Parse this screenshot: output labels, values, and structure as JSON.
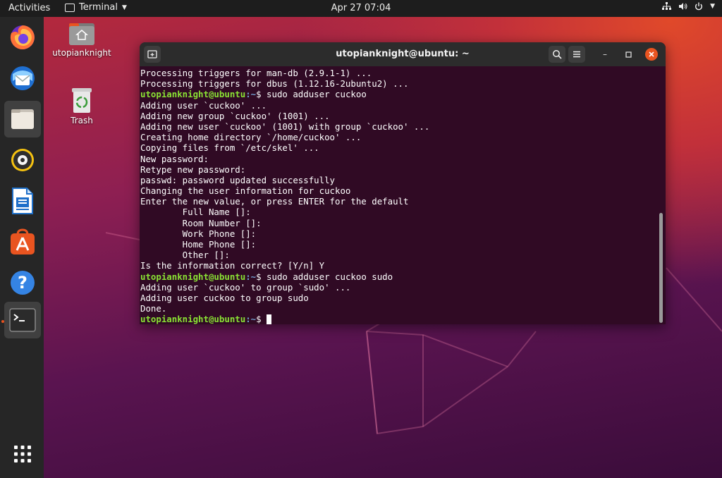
{
  "topbar": {
    "activities": "Activities",
    "app_name": "Terminal",
    "clock": "Apr 27  07:04",
    "status_icons": [
      "network-icon",
      "volume-icon",
      "power-icon",
      "menu-caret-icon"
    ]
  },
  "dock": {
    "items": [
      {
        "name": "firefox",
        "icon": "firefox-icon"
      },
      {
        "name": "thunderbird",
        "icon": "thunderbird-icon"
      },
      {
        "name": "files",
        "icon": "files-icon"
      },
      {
        "name": "rhythmbox",
        "icon": "rhythmbox-icon"
      },
      {
        "name": "libreoffice-writer",
        "icon": "writer-icon"
      },
      {
        "name": "software",
        "icon": "software-center-icon"
      },
      {
        "name": "help",
        "icon": "help-icon"
      },
      {
        "name": "terminal",
        "icon": "terminal-icon"
      }
    ],
    "show_apps_icon": "grid-icon"
  },
  "desktop": {
    "home_label": "utopianknight",
    "trash_label": "Trash"
  },
  "terminal": {
    "title": "utopianknight@ubuntu: ~",
    "prompt_user": "utopianknight@ubuntu",
    "prompt_path": ":~",
    "prompt_symbol": "$ ",
    "lines": [
      {
        "type": "out",
        "text": "Processing triggers for man-db (2.9.1-1) ..."
      },
      {
        "type": "out",
        "text": "Processing triggers for dbus (1.12.16-2ubuntu2) ..."
      },
      {
        "type": "cmd",
        "text": "sudo adduser cuckoo"
      },
      {
        "type": "out",
        "text": "Adding user `cuckoo' ..."
      },
      {
        "type": "out",
        "text": "Adding new group `cuckoo' (1001) ..."
      },
      {
        "type": "out",
        "text": "Adding new user `cuckoo' (1001) with group `cuckoo' ..."
      },
      {
        "type": "out",
        "text": "Creating home directory `/home/cuckoo' ..."
      },
      {
        "type": "out",
        "text": "Copying files from `/etc/skel' ..."
      },
      {
        "type": "out",
        "text": "New password:"
      },
      {
        "type": "out",
        "text": "Retype new password:"
      },
      {
        "type": "out",
        "text": "passwd: password updated successfully"
      },
      {
        "type": "out",
        "text": "Changing the user information for cuckoo"
      },
      {
        "type": "out",
        "text": "Enter the new value, or press ENTER for the default"
      },
      {
        "type": "out",
        "text": "        Full Name []:"
      },
      {
        "type": "out",
        "text": "        Room Number []:"
      },
      {
        "type": "out",
        "text": "        Work Phone []:"
      },
      {
        "type": "out",
        "text": "        Home Phone []:"
      },
      {
        "type": "out",
        "text": "        Other []:"
      },
      {
        "type": "out",
        "text": "Is the information correct? [Y/n] Y"
      },
      {
        "type": "cmd",
        "text": "sudo adduser cuckoo sudo"
      },
      {
        "type": "out",
        "text": "Adding user `cuckoo' to group `sudo' ..."
      },
      {
        "type": "out",
        "text": "Adding user cuckoo to group sudo"
      },
      {
        "type": "out",
        "text": "Done."
      },
      {
        "type": "cmd",
        "text": "",
        "cursor": true
      }
    ]
  },
  "colors": {
    "terminal_bg": "#300a24",
    "prompt_user": "#8ae234",
    "prompt_path": "#729fcf",
    "accent": "#e95420"
  }
}
